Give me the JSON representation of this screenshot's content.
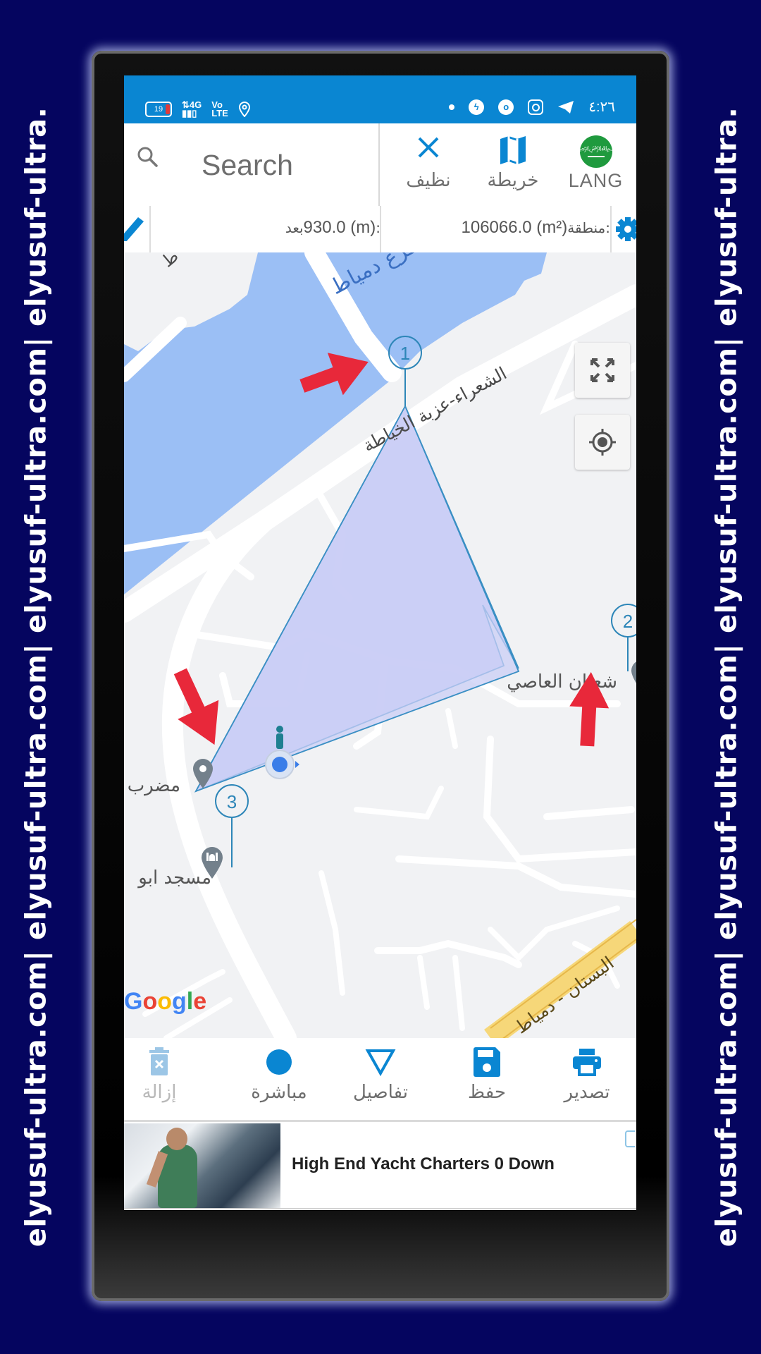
{
  "watermark": {
    "text": "elyusuf-ultra.com| elyusuf-ultra.com| elyusuf-ultra.com| elyusuf-ultra."
  },
  "status_bar": {
    "battery_level": "19",
    "network": "4G",
    "volte": "Vo LTE",
    "time": "٤:٢٦",
    "icons": [
      "battery-icon",
      "signal-4g-icon",
      "volte-icon",
      "location-icon",
      "notification-dot-icon",
      "messenger-icon",
      "vodafone-icon",
      "instagram-icon",
      "telegram-icon"
    ]
  },
  "header": {
    "search_placeholder": "Search",
    "clear_label": "نظيف",
    "map_label": "خريطة",
    "lang_label": "LANG"
  },
  "info_bar": {
    "distance_key": "بعد:",
    "distance_value": "930.0 (m)",
    "area_key": "منطقة:",
    "area_value": "106066.0 (m²)"
  },
  "map": {
    "labels": {
      "river": "فرع دمياط",
      "road_main": "الشعراء-عزبة الخياطة",
      "place_right": "شعبان العاصي",
      "place_left": "مضرب",
      "mosque": "مسجد ابو",
      "highway": "البستان - دمياط",
      "road_topleft": "ط",
      "attribution": "Google"
    },
    "markers": [
      {
        "id": "1"
      },
      {
        "id": "2"
      },
      {
        "id": "3"
      }
    ],
    "polygon_fill": "#c9cdf5",
    "polygon_stroke": "#3a8fc4",
    "water_color": "#9bbff5",
    "arrow_color": "#e8283a"
  },
  "toolbar": {
    "items": [
      {
        "label": "تصدير",
        "icon": "printer-icon"
      },
      {
        "label": "حفظ",
        "icon": "save-icon"
      },
      {
        "label": "تفاصيل",
        "icon": "triangle-icon"
      },
      {
        "label": "مباشرة",
        "icon": "circle-icon"
      },
      {
        "label": "إزالة",
        "icon": "delete-icon"
      }
    ],
    "accent": "#0a86d2"
  },
  "ad": {
    "title": "High End Yacht Charters 0 Down"
  }
}
